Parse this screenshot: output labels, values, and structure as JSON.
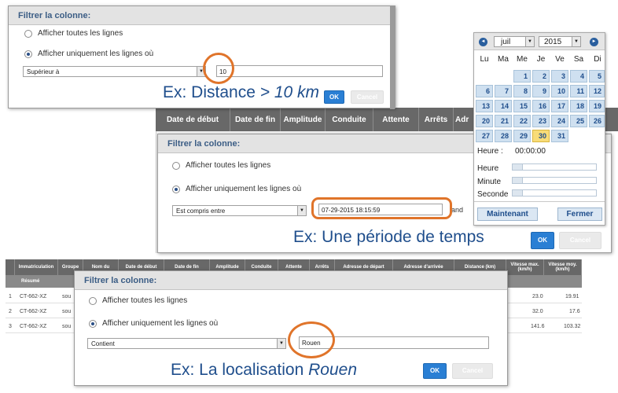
{
  "dialog1": {
    "title": "Filtrer la colonne:",
    "radio_all": "Afficher toutes les lignes",
    "radio_only": "Afficher uniquement les lignes où",
    "select_value": "Supérieur à",
    "input_value": "10",
    "caption_prefix": "Ex: Distance ",
    "caption_value": "> 10 km",
    "ok": "OK",
    "cancel": "Cancel"
  },
  "grid2": {
    "headers": [
      "Date de début",
      "Date de fin",
      "Amplitude",
      "Conduite",
      "Attente",
      "Arrêts",
      "Adr"
    ]
  },
  "dialog2": {
    "title": "Filtrer la colonne:",
    "radio_all": "Afficher toutes les lignes",
    "radio_only": "Afficher uniquement les lignes où",
    "select_value": "Est compris entre",
    "input_value": "07-29-2015 18:15:59",
    "and_label": "and",
    "caption": "Ex: Une période de temps",
    "ok": "OK",
    "cancel": "Cancel"
  },
  "calendar": {
    "month": "juil",
    "year": "2015",
    "weekdays": [
      "Lu",
      "Ma",
      "Me",
      "Je",
      "Ve",
      "Sa",
      "Di"
    ],
    "days": [
      [
        null,
        null,
        "1",
        "2",
        "3",
        "4",
        "5"
      ],
      [
        "6",
        "7",
        "8",
        "9",
        "10",
        "11",
        "12"
      ],
      [
        "13",
        "14",
        "15",
        "16",
        "17",
        "18",
        "19"
      ],
      [
        "20",
        "21",
        "22",
        "23",
        "24",
        "25",
        "26"
      ],
      [
        "27",
        "28",
        "29",
        "30",
        "31",
        null,
        null
      ]
    ],
    "selected_day": "30",
    "heure_label": "Heure :",
    "time_value": "00:00:00",
    "sliders": [
      "Heure",
      "Minute",
      "Seconde"
    ],
    "now_button": "Maintenant",
    "close_button": "Fermer",
    "prev_icon": "◄",
    "next_icon": "►"
  },
  "grid3": {
    "headers": [
      "",
      "Immatriculation",
      "Groupe",
      "Nom du",
      "Date de début",
      "Date de fin",
      "Amplitude",
      "Conduite",
      "Attente",
      "Arrêts",
      "Adresse de départ",
      "Adresse d'arrivée",
      "Distance (km)",
      "Vitesse max. (km/h)",
      "Vitesse moy. (km/h)"
    ],
    "summary_label": "Résumé",
    "rows": [
      {
        "num": "1",
        "immat": "CT-662-XZ",
        "groupe": "sou",
        "vmax": "23.0",
        "vmoy": "19.91"
      },
      {
        "num": "2",
        "immat": "CT-662-XZ",
        "groupe": "sou",
        "vmax": "32.0",
        "vmoy": "17.6"
      },
      {
        "num": "3",
        "immat": "CT-662-XZ",
        "groupe": "sou",
        "vmax": "141.6",
        "vmoy": "103.32"
      }
    ]
  },
  "dialog3": {
    "title": "Filtrer la colonne:",
    "radio_all": "Afficher toutes les lignes",
    "radio_only": "Afficher uniquement les lignes où",
    "select_value": "Contient",
    "input_value": "Rouen",
    "caption_prefix": "Ex: La localisation ",
    "caption_value": "Rouen",
    "ok": "OK",
    "cancel": "Cancel"
  },
  "colors": {
    "accent": "#2a7fd4",
    "title_text": "#3b5d85",
    "highlight": "#e0742a",
    "caption_text": "#1f4e8c"
  }
}
